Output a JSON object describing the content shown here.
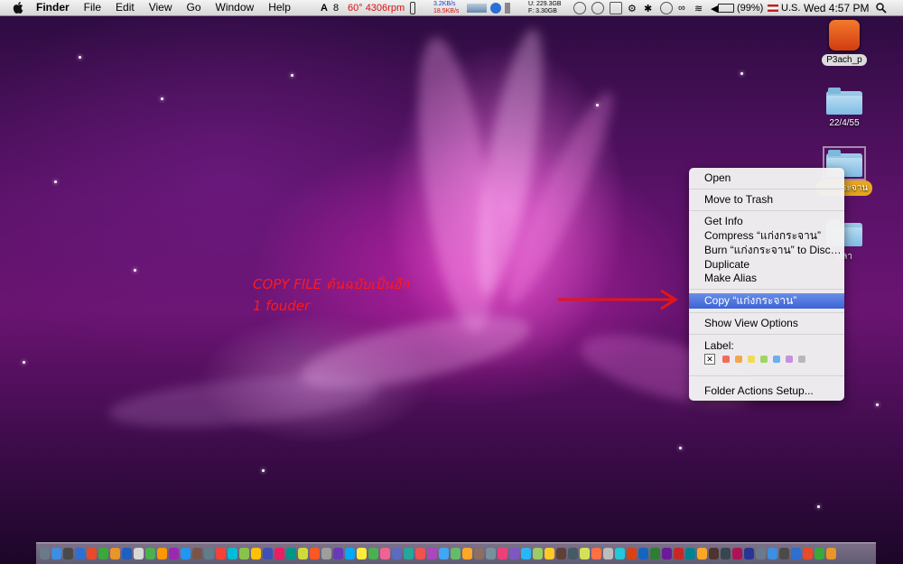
{
  "menubar": {
    "app_name": "Finder",
    "menus": [
      "File",
      "Edit",
      "View",
      "Go",
      "Window",
      "Help"
    ],
    "status": {
      "fan_text": "60° 4306rpm",
      "cpu_count": "8",
      "net_up": "3.2KB/s",
      "net_down": "18.5KB/s",
      "disk_used": "U: 229.3GB",
      "disk_free": "F:    3.30GB",
      "battery": "(99%)",
      "input_source": "U.S.",
      "clock": "Wed 4:57 PM"
    }
  },
  "desktop": {
    "icons": [
      {
        "label": "P3ach_p"
      },
      {
        "label": "22/4/55"
      },
      {
        "label": "แก่งกระจาน"
      },
      {
        "label": "ปลา"
      }
    ]
  },
  "context_menu": {
    "items": {
      "open": "Open",
      "move_to_trash": "Move to Trash",
      "get_info": "Get Info",
      "compress": "Compress “แก่งกระจาน”",
      "burn": "Burn “แก่งกระจาน” to Disc…",
      "duplicate": "Duplicate",
      "make_alias": "Make Alias",
      "copy": "Copy “แก่งกระจาน”",
      "show_view_options": "Show View Options",
      "label": "Label:",
      "folder_actions_setup": "Folder Actions Setup..."
    },
    "label_colors": [
      "#f26a5a",
      "#f5a64a",
      "#efdc54",
      "#9ed663",
      "#6aaef2",
      "#c490e0",
      "#b8b8b8"
    ],
    "highlighted": "copy"
  },
  "annotation": {
    "line1": "COPY FILE ต้นฉบับเป็นอีก",
    "line2": "1 fouder"
  }
}
